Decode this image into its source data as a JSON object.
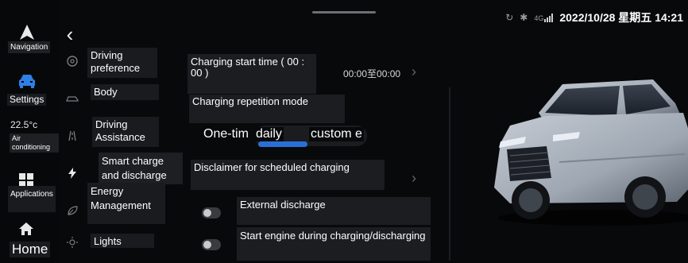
{
  "status_bar": {
    "network": "4G",
    "datetime": "2022/10/28 星期五 14:21"
  },
  "dock": {
    "navigation_label": "Navigation",
    "settings_label": "Settings",
    "temperature": "22.5°c",
    "air_label": "Air conditioning",
    "applications_label": "Applications",
    "home_label": "Home"
  },
  "menu": {
    "items": [
      {
        "label": "Driving preference",
        "icon": "steering-wheel-icon"
      },
      {
        "label": "Body",
        "icon": "car-body-icon"
      },
      {
        "label": "Driving Assistance",
        "icon": "lane-assist-icon"
      },
      {
        "label": "Smart charge and discharge",
        "icon": "lightning-icon"
      },
      {
        "label": "Energy Management",
        "icon": "leaf-icon"
      },
      {
        "label": "Lights",
        "icon": "light-icon"
      }
    ]
  },
  "content": {
    "charging_start_time_label": "Charging start time ( 00 : 00 )",
    "charging_time_value": "00:00至00:00",
    "repetition_label": "Charging repetition mode",
    "repetition_options": [
      "One-tim",
      "daily",
      "custom e"
    ],
    "selected_option": "daily",
    "disclaimer_label": "Disclaimer for scheduled charging",
    "external_discharge_label": "External discharge",
    "external_discharge_on": false,
    "start_engine_label": "Start engine during charging/discharging",
    "start_engine_on": false
  },
  "colors": {
    "background": "#08090b",
    "label_box": "#1c1d20",
    "accent": "#2a6fd6",
    "dock_accent": "#2f7fe6"
  }
}
